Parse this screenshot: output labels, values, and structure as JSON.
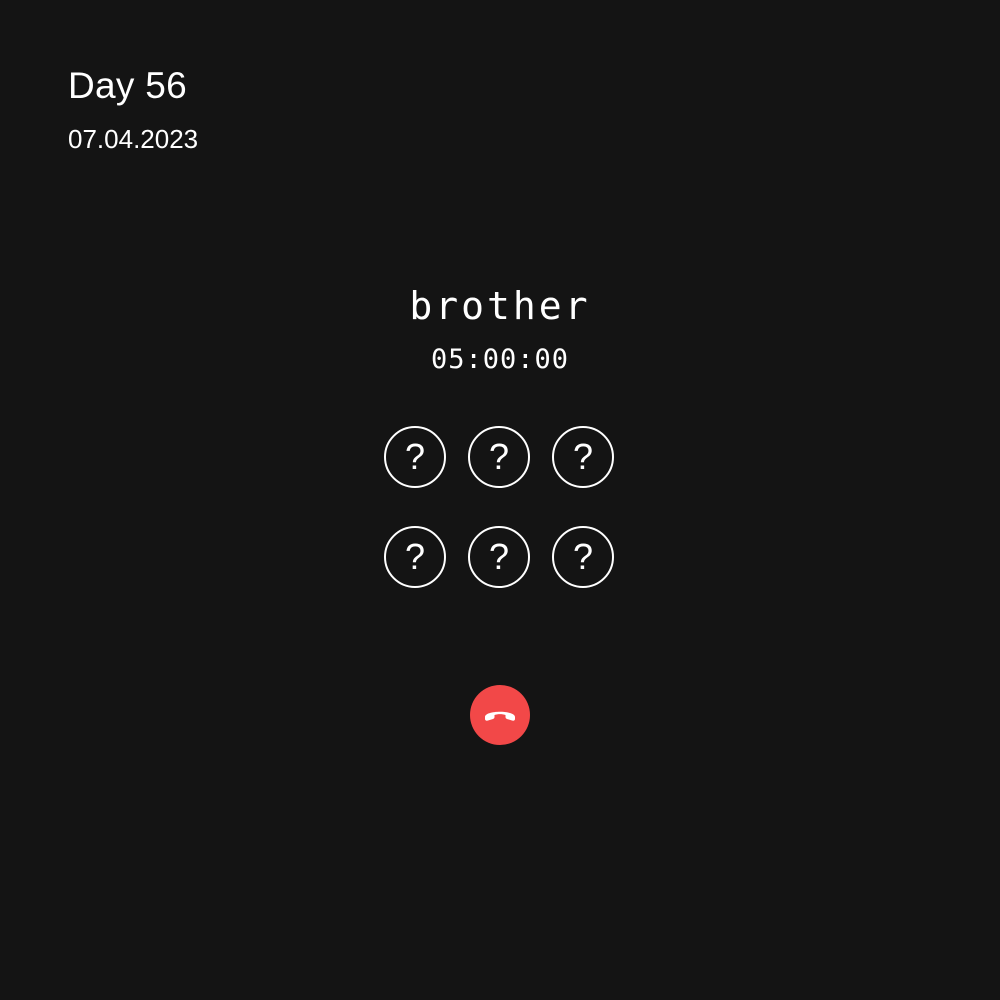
{
  "header": {
    "day": "Day 56",
    "date": "07.04.2023"
  },
  "call": {
    "caller": "brother",
    "timer": "05:00:00"
  },
  "keypad": {
    "keys": [
      "?",
      "?",
      "?",
      "?",
      "?",
      "?"
    ]
  },
  "hangup_button": {
    "icon": "phone-hangup-icon",
    "color": "#f24848"
  },
  "colors": {
    "background": "#141414",
    "text": "#ffffff",
    "hangup": "#f24848"
  }
}
